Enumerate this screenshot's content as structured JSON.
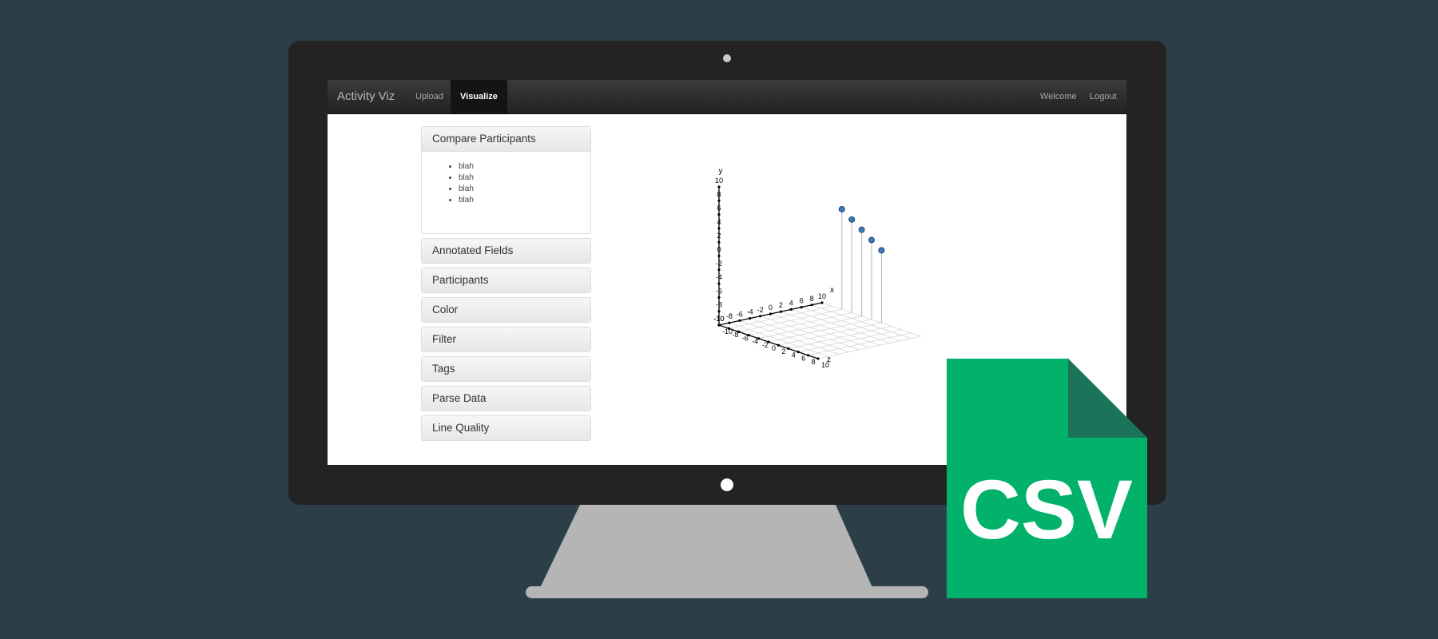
{
  "navbar": {
    "brand": "Activity Viz",
    "links": [
      {
        "label": "Upload",
        "active": false
      },
      {
        "label": "Visualize",
        "active": true
      }
    ],
    "right_links": [
      "Welcome",
      "Logout"
    ]
  },
  "accordion": {
    "panels": [
      {
        "label": "Compare Participants",
        "open": true,
        "items": [
          "blah",
          "blah",
          "blah",
          "blah"
        ]
      },
      {
        "label": "Annotated Fields"
      },
      {
        "label": "Participants"
      },
      {
        "label": "Color"
      },
      {
        "label": "Filter"
      },
      {
        "label": "Tags"
      },
      {
        "label": "Parse Data"
      },
      {
        "label": "Line Quality"
      }
    ]
  },
  "chart_data": {
    "type": "scatter",
    "projection": "3d",
    "axes": {
      "x": {
        "label": "x",
        "range": [
          -10,
          10
        ],
        "ticks": [
          "-10",
          "-8",
          "-6",
          "-4",
          "-2",
          "0",
          "2",
          "4",
          "6",
          "8",
          "10"
        ]
      },
      "y": {
        "label": "y",
        "range": [
          -10,
          10
        ],
        "ticks": [
          "-10",
          "-8",
          "-6",
          "-4",
          "-2",
          "0",
          "2",
          "4",
          "6",
          "8",
          "10"
        ]
      },
      "z": {
        "label": "z",
        "range": [
          -10,
          10
        ],
        "ticks": [
          "-10",
          "-8",
          "-6",
          "-4",
          "-2",
          "0",
          "2",
          "4",
          "6",
          "8",
          "10"
        ]
      }
    },
    "points": [
      {
        "x": 10,
        "y": 0.5,
        "z": 2
      },
      {
        "x": 10,
        "y": 1.5,
        "z": 0
      },
      {
        "x": 10,
        "y": 2.5,
        "z": -2
      },
      {
        "x": 10,
        "y": 3.5,
        "z": -4
      },
      {
        "x": 10,
        "y": 4.5,
        "z": -6
      }
    ],
    "drop_lines": true,
    "grid": "xz-plane",
    "point_color": "#3a78b5"
  },
  "csv_icon": {
    "label": "CSV",
    "color": "#02b26b",
    "fold_color": "#1b7459"
  }
}
